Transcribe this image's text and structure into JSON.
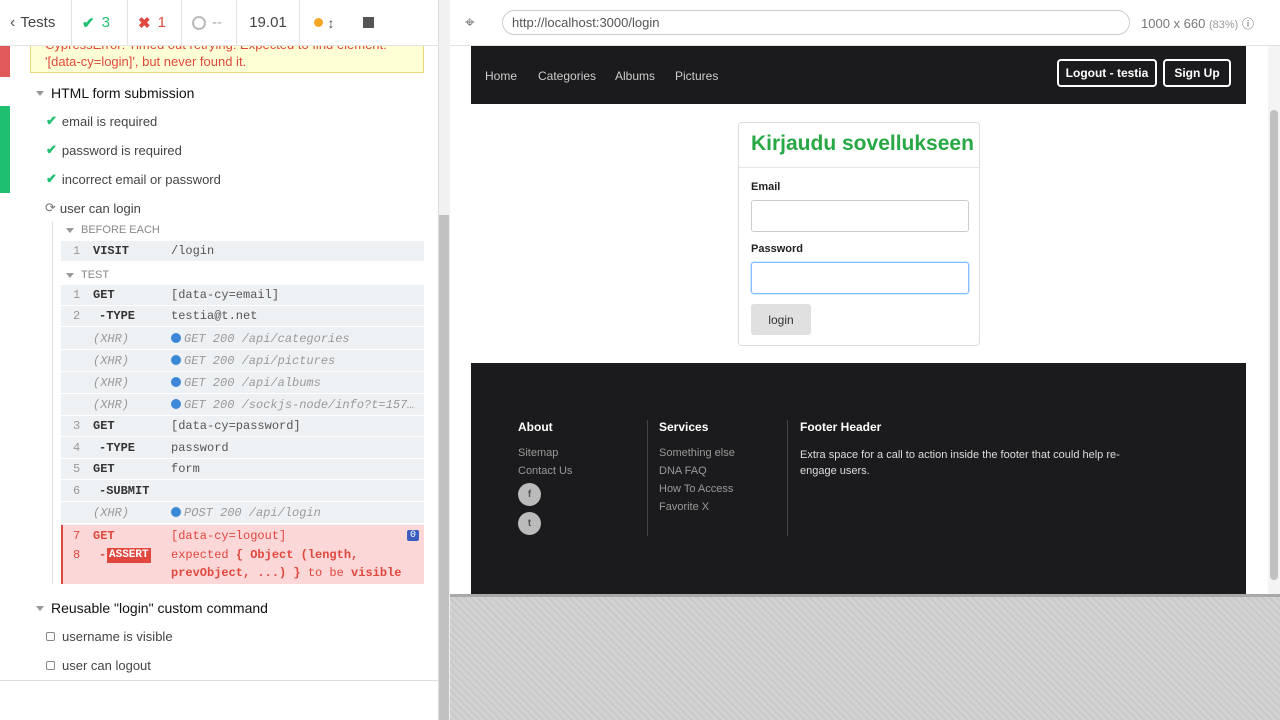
{
  "reporter": {
    "tests_label": "Tests",
    "passed": "3",
    "failed": "1",
    "pending": "--",
    "duration": "19.01",
    "error_text": "CypressError: Timed out retrying: Expected to find element: '[data-cy=login]', but never found it.",
    "suites": [
      {
        "title": "HTML form submission",
        "tests": [
          {
            "title": "email is required",
            "state": "passed"
          },
          {
            "title": "password is required",
            "state": "passed"
          },
          {
            "title": "incorrect email or password",
            "state": "passed"
          },
          {
            "title": "user can login",
            "state": "running"
          }
        ]
      },
      {
        "title": "Reusable \"login\" custom command",
        "tests": [
          {
            "title": "username is visible",
            "state": "pending"
          },
          {
            "title": "user can logout",
            "state": "pending"
          }
        ]
      }
    ],
    "before_each_label": "BEFORE EACH",
    "before_each": [
      {
        "num": "1",
        "name": "VISIT",
        "msg": "/login"
      }
    ],
    "test_label": "TEST",
    "commands": [
      {
        "num": "1",
        "name": "GET",
        "msg": "[data-cy=email]"
      },
      {
        "num": "2",
        "name": "-TYPE",
        "msg": "testia@t.net"
      },
      {
        "num": "",
        "name": "(XHR)",
        "msg": "GET 200 /api/categories",
        "xhr": true
      },
      {
        "num": "",
        "name": "(XHR)",
        "msg": "GET 200 /api/pictures",
        "xhr": true
      },
      {
        "num": "",
        "name": "(XHR)",
        "msg": "GET 200 /api/albums",
        "xhr": true
      },
      {
        "num": "",
        "name": "(XHR)",
        "msg": "GET 200 /sockjs-node/info?t=157…",
        "xhr": true
      },
      {
        "num": "3",
        "name": "GET",
        "msg": "[data-cy=password]"
      },
      {
        "num": "4",
        "name": "-TYPE",
        "msg": "password"
      },
      {
        "num": "5",
        "name": "GET",
        "msg": "form"
      },
      {
        "num": "6",
        "name": "-SUBMIT",
        "msg": ""
      },
      {
        "num": "",
        "name": "(XHR)",
        "msg": "POST 200 /api/login",
        "xhr": true
      }
    ],
    "failed_get": {
      "num": "7",
      "name": "GET",
      "msg": "[data-cy=logout]",
      "badge": "0"
    },
    "failed_assert": {
      "num": "8",
      "name": "ASSERT",
      "line1_a": "expected ",
      "line1_b": "{ Object (length,",
      "line2_a": "prevObject, ...) }",
      "line2_b": " to be ",
      "line2_c": "visible"
    }
  },
  "browser": {
    "url": "http://localhost:3000/login",
    "viewport_size": "1000 x 660",
    "zoom": "(83%)"
  },
  "app": {
    "nav": [
      "Home",
      "Categories",
      "Albums",
      "Pictures"
    ],
    "logout_label": "Logout - testia",
    "signup_label": "Sign Up",
    "login_title": "Kirjaudu sovellukseen",
    "email_label": "Email",
    "password_label": "Password",
    "login_button": "login",
    "footer": {
      "about_title": "About",
      "about_links": [
        "Sitemap",
        "Contact Us"
      ],
      "services_title": "Services",
      "services_links": [
        "Something else",
        "DNA FAQ",
        "How To Access",
        "Favorite X"
      ],
      "header_title": "Footer Header",
      "header_text": "Extra space for a call to action inside the footer that could help re-engage users."
    }
  },
  "colors": {
    "pass": "#1fbf70",
    "fail": "#e0473e",
    "xhr_dot": "#3c87d8",
    "app_green": "#28a745",
    "dark": "#1b1b1d"
  }
}
